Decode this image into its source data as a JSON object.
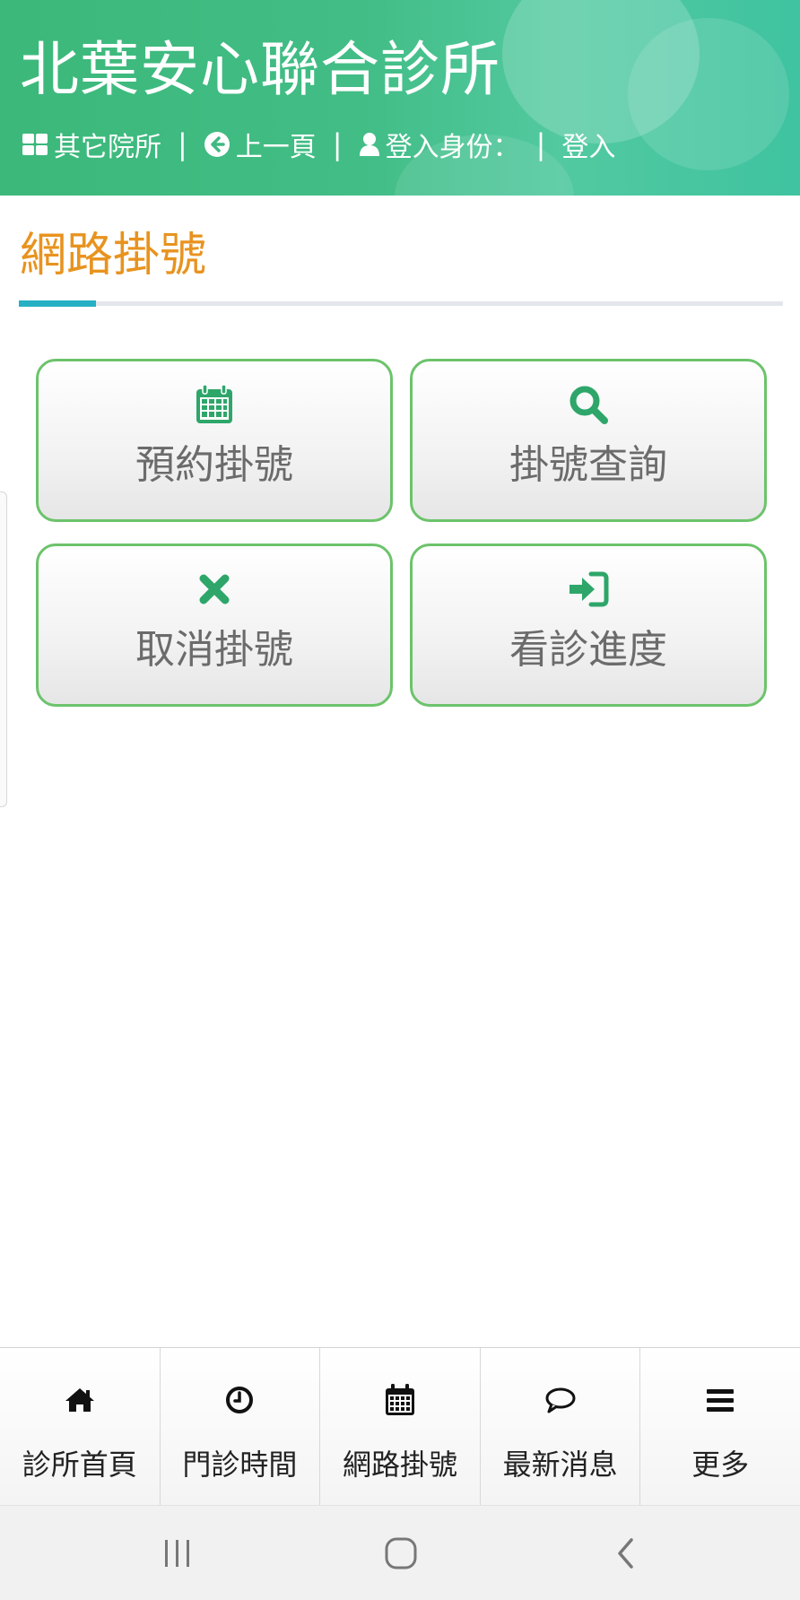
{
  "header": {
    "title": "北葉安心聯合診所",
    "nav": {
      "other_clinics": "其它院所",
      "separator": "|",
      "back": "上一頁",
      "login_identity": "登入身份：",
      "login": "登入"
    }
  },
  "section": {
    "title": "網路掛號"
  },
  "actions": [
    {
      "label": "預約掛號",
      "icon": "calendar-icon"
    },
    {
      "label": "掛號查詢",
      "icon": "search-icon"
    },
    {
      "label": "取消掛號",
      "icon": "close-icon"
    },
    {
      "label": "看診進度",
      "icon": "sign-in-icon"
    }
  ],
  "bottom_nav": [
    {
      "label": "診所首頁",
      "icon": "home-icon"
    },
    {
      "label": "門診時間",
      "icon": "clock-icon"
    },
    {
      "label": "網路掛號",
      "icon": "calendar-icon"
    },
    {
      "label": "最新消息",
      "icon": "speech-bubble-icon"
    },
    {
      "label": "更多",
      "icon": "menu-icon"
    }
  ],
  "colors": {
    "header_green": "#3cb87a",
    "accent_orange": "#e8931f",
    "accent_teal": "#25b0c4",
    "button_border_green": "#6cc36b",
    "icon_green": "#2ea66a"
  }
}
